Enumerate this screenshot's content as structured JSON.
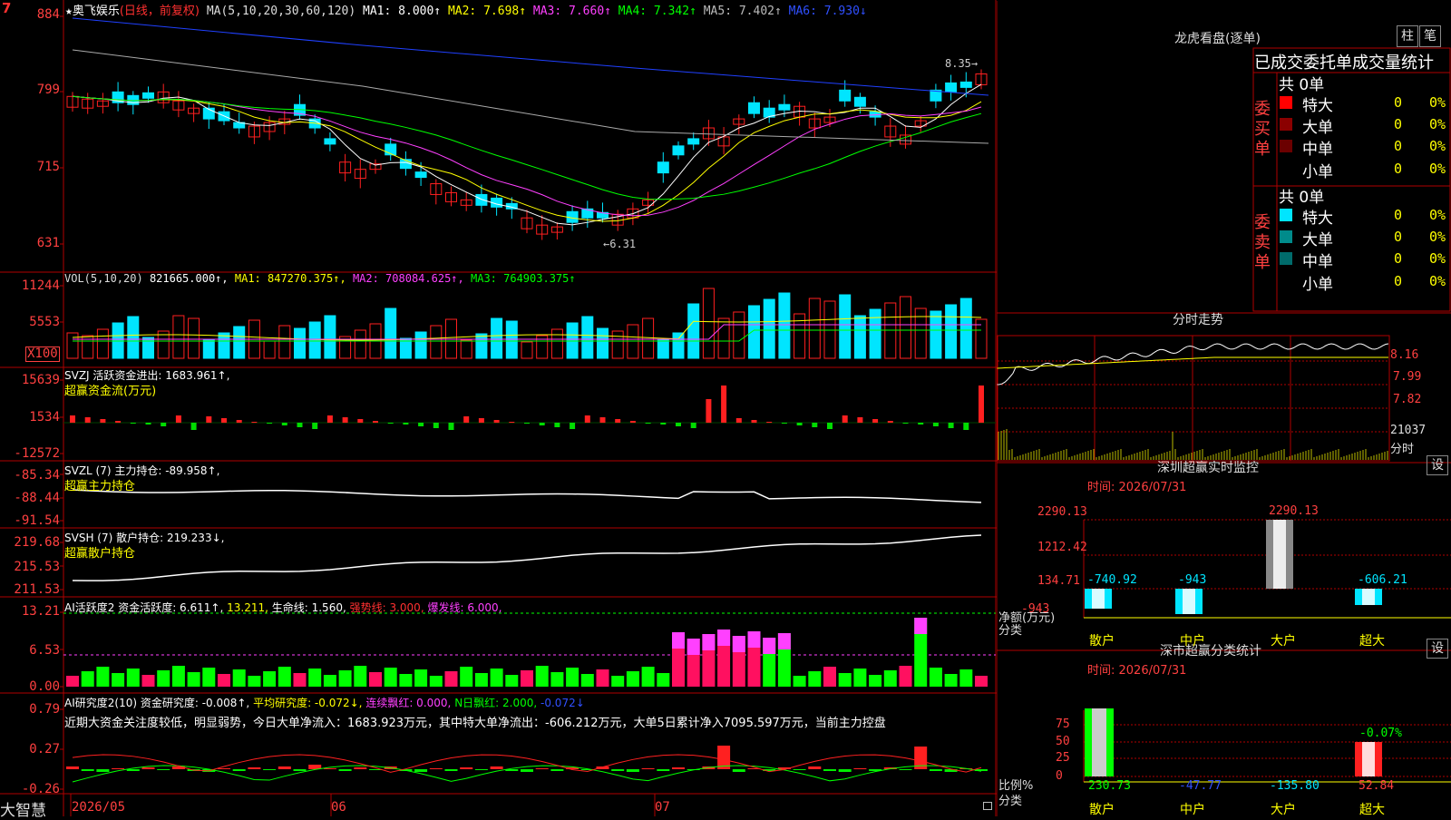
{
  "header": {
    "stock_name": "奥飞娱乐",
    "mode": "(日线，前复权)",
    "ma_params": "MA(5,10,20,30,60,120)",
    "ma1": "MA1: 8.000↑",
    "ma2": "MA2: 7.698↑",
    "ma3": "MA3: 7.660↑",
    "ma4": "MA4: 7.342↑",
    "ma5": "MA5: 7.402↑",
    "ma6": "MA6: 7.930↓",
    "corner": "7"
  },
  "price_axis": [
    "884",
    "799",
    "715",
    "631"
  ],
  "price_marks": {
    "high": "8.35",
    "low": "6.31"
  },
  "vol": {
    "params": "VOL(5,10,20)",
    "value": "821665.000↑,",
    "ma1": "MA1: 847270.375↑,",
    "ma2": "MA2: 708084.625↑,",
    "ma3": "MA3: 764903.375↑",
    "axis": [
      "11244",
      "5553"
    ],
    "unit": "X100"
  },
  "svzj": {
    "title": "SVZJ  活跃资金进出: 1683.961↑,",
    "subtitle": "超赢资金流(万元)",
    "axis": [
      "15639",
      "1534",
      "-12572"
    ]
  },
  "svzl": {
    "title": "SVZL (7) 主力持仓: -89.958↑,",
    "subtitle": "超赢主力持仓",
    "axis": [
      "-85.34",
      "-88.44",
      "-91.54"
    ]
  },
  "svsh": {
    "title": "SVSH (7) 散户持仓: 219.233↓,",
    "subtitle": "超赢散户持仓",
    "axis": [
      "219.68",
      "215.53",
      "211.53"
    ]
  },
  "ai_active": {
    "t1": "AI活跃度2 资金活跃度: 6.611↑,",
    "t2": "13.211,",
    "t3": "生命线: 1.560,",
    "t4": "强势线: 3.000,",
    "t5": "爆发线: 6.000,",
    "axis": [
      "13.21",
      "6.53",
      "0.00"
    ]
  },
  "ai_research": {
    "t1": "AI研究度2(10) 资金研究度: -0.008↑,",
    "t2": "平均研究度: -0.072↓,",
    "t3": "连续飘红: 0.000,",
    "t4": "N日飘红: 2.000,",
    "t5": "-0.072↓",
    "desc": "近期大资金关注度较低，明显弱势，今日大单净流入：1683.923万元，其中特大单净流出：-606.212万元，大单5日累计净入7095.597万元，当前主力控盘",
    "axis": [
      "0.79",
      "0.27",
      "-0.26"
    ]
  },
  "bottom": {
    "logo": "大智慧",
    "dates": [
      "2026/05",
      "06",
      "07"
    ]
  },
  "longhu": {
    "title": "龙虎看盘(逐单)",
    "btn1": "柱",
    "btn2": "笔",
    "tabs": "已成交委托单成交量统计",
    "buy_label": "委买单",
    "sell_label": "委卖单",
    "buy_total": "共 0单",
    "sell_total": "共 0单",
    "rows": [
      {
        "label": "特大",
        "count": "0",
        "pct": "0%"
      },
      {
        "label": "大单",
        "count": "0",
        "pct": "0%"
      },
      {
        "label": "中单",
        "count": "0",
        "pct": "0%"
      },
      {
        "label": "小单",
        "count": "0",
        "pct": "0%"
      }
    ],
    "colors_buy": [
      "#ff0000",
      "#8b0000",
      "#6b0000",
      "#000000"
    ],
    "colors_sell": [
      "#00e5ff",
      "#008b8b",
      "#006b6b",
      "#000000"
    ]
  },
  "intraday": {
    "title": "分时走势",
    "axis": [
      "8.16",
      "7.99",
      "7.82"
    ],
    "vol_label": "21037",
    "vol_unit": "分时"
  },
  "monitor": {
    "title": "深圳超赢实时监控",
    "btn": "设",
    "time": "时间: 2026/07/31",
    "axis": [
      "2290.13",
      "1212.42",
      "134.71",
      "-943"
    ],
    "bar_labels": [
      "-740.92",
      "-943",
      "2290.13",
      "-606.21"
    ],
    "ylabel": "净额(万元)",
    "xlabel": "分类",
    "categories": [
      "散户",
      "中户",
      "大户",
      "超大"
    ]
  },
  "classstat": {
    "title": "深市超赢分类统计",
    "btn": "设",
    "time": "时间: 2026/07/31",
    "axis": [
      "75",
      "50",
      "25",
      "0"
    ],
    "bar_labels": [
      "230.73",
      "-47.77",
      "-135.80",
      "52.84"
    ],
    "top_label": "-0.07%",
    "ylabel": "比例%",
    "xlabel": "分类",
    "categories": [
      "散户",
      "中户",
      "大户",
      "超大"
    ]
  },
  "colors": {
    "up": "#ff2020",
    "down": "#00e5ff",
    "grid": "#b00000"
  }
}
